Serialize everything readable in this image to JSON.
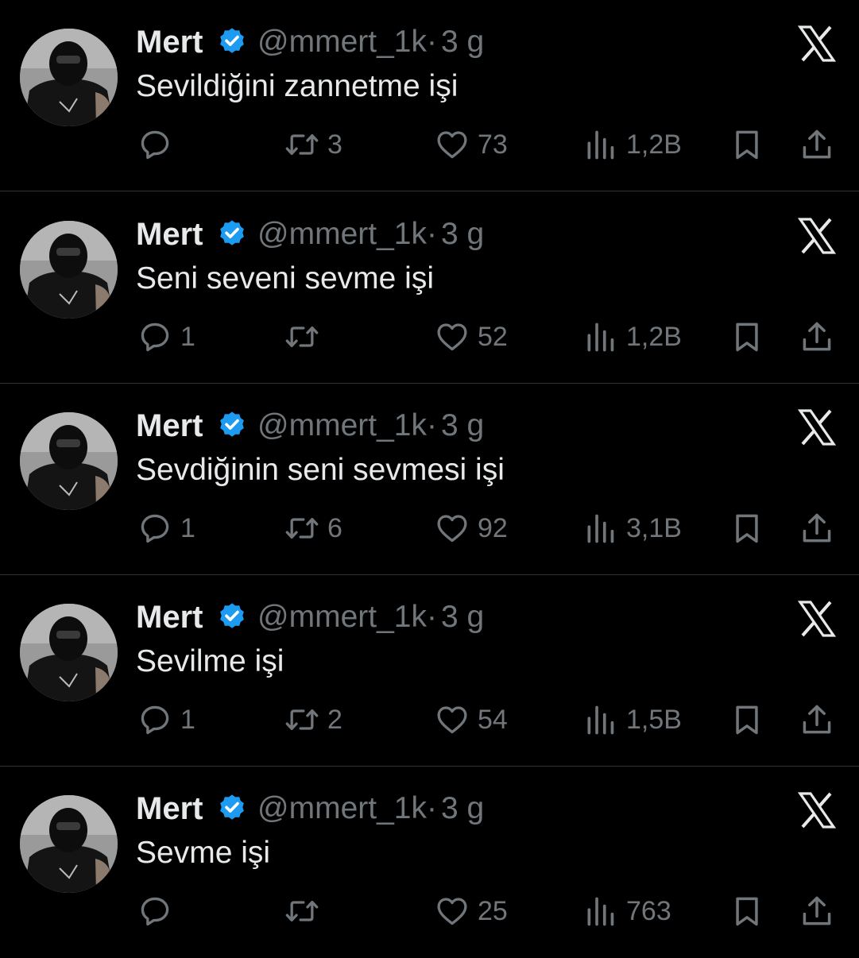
{
  "colors": {
    "background": "#000000",
    "primary_text": "#e7e9ea",
    "secondary_text": "#71767b",
    "divider": "#2f3336",
    "verified_blue": "#1d9bf0"
  },
  "icons": {
    "reply": "speech-bubble-icon",
    "retweet": "retweet-arrows-icon",
    "like": "heart-icon",
    "views": "bar-chart-icon",
    "bookmark": "bookmark-icon",
    "share": "share-upload-icon",
    "platform": "x-logo-icon",
    "verified": "verified-badge-icon"
  },
  "tweets": [
    {
      "name": "Mert",
      "handle": "@mmert_1k",
      "separator": "·",
      "time": "3 g",
      "text": "Sevildiğini zannetme işi",
      "replies": "",
      "retweets": "3",
      "likes": "73",
      "views": "1,2B"
    },
    {
      "name": "Mert",
      "handle": "@mmert_1k",
      "separator": "·",
      "time": "3 g",
      "text": "Seni seveni sevme işi",
      "replies": "1",
      "retweets": "",
      "likes": "52",
      "views": "1,2B"
    },
    {
      "name": "Mert",
      "handle": "@mmert_1k",
      "separator": "·",
      "time": "3 g",
      "text": "Sevdiğinin seni sevmesi işi",
      "replies": "1",
      "retweets": "6",
      "likes": "92",
      "views": "3,1B"
    },
    {
      "name": "Mert",
      "handle": "@mmert_1k",
      "separator": "·",
      "time": "3 g",
      "text": "Sevilme işi",
      "replies": "1",
      "retweets": "2",
      "likes": "54",
      "views": "1,5B"
    },
    {
      "name": "Mert",
      "handle": "@mmert_1k",
      "separator": "·",
      "time": "3 g",
      "text": "Sevme işi",
      "replies": "",
      "retweets": "",
      "likes": "25",
      "views": "763"
    }
  ]
}
